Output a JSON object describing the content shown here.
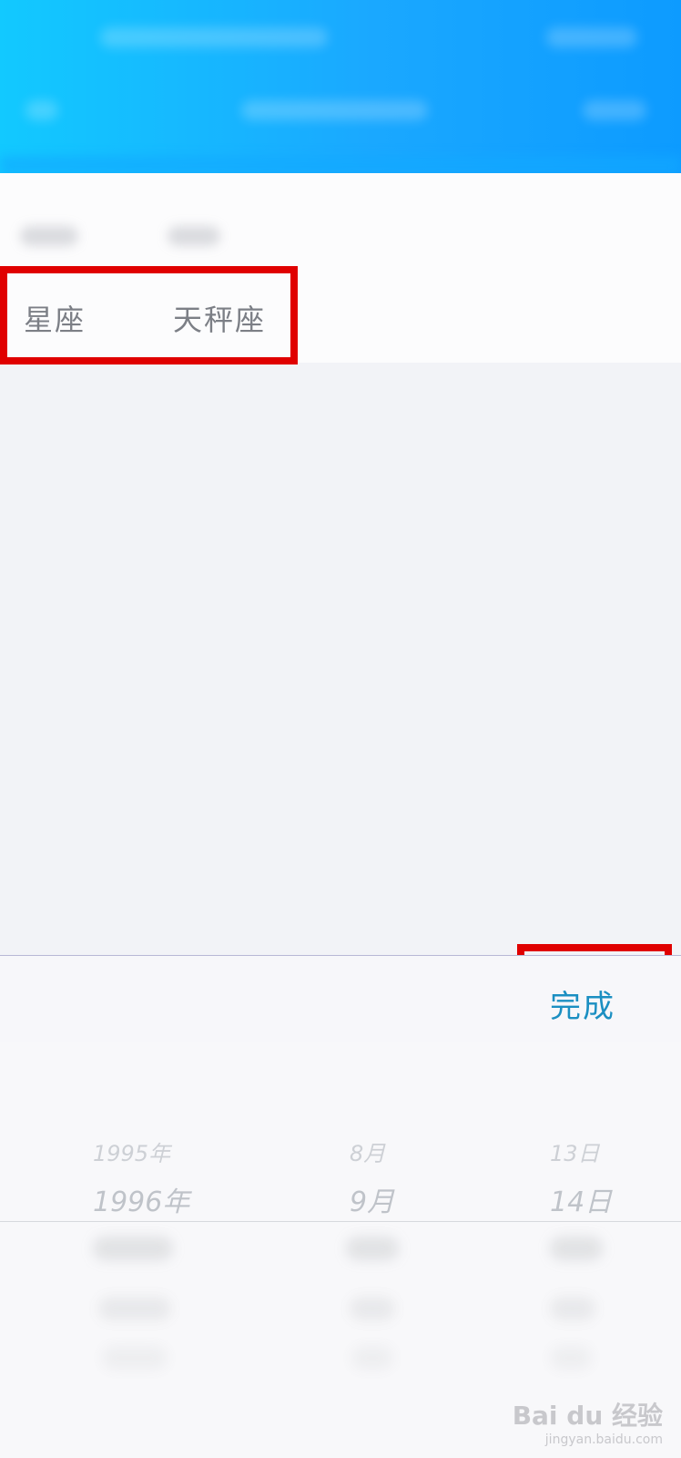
{
  "profile": {
    "constellation_label": "星座",
    "constellation_value": "天秤座"
  },
  "toolbar": {
    "done_label": "完成"
  },
  "picker": {
    "year_prev": "1995年",
    "month_prev": "8月",
    "day_prev": "13日",
    "year_next": "1996年",
    "month_next": "9月",
    "day_next": "14日"
  },
  "watermark": {
    "brand": "Bai du 经验",
    "url": "jingyan.baidu.com"
  },
  "colors": {
    "header_blue": "#1aa8ff",
    "highlight_red": "#e00000",
    "done_blue": "#1b8fc2"
  }
}
